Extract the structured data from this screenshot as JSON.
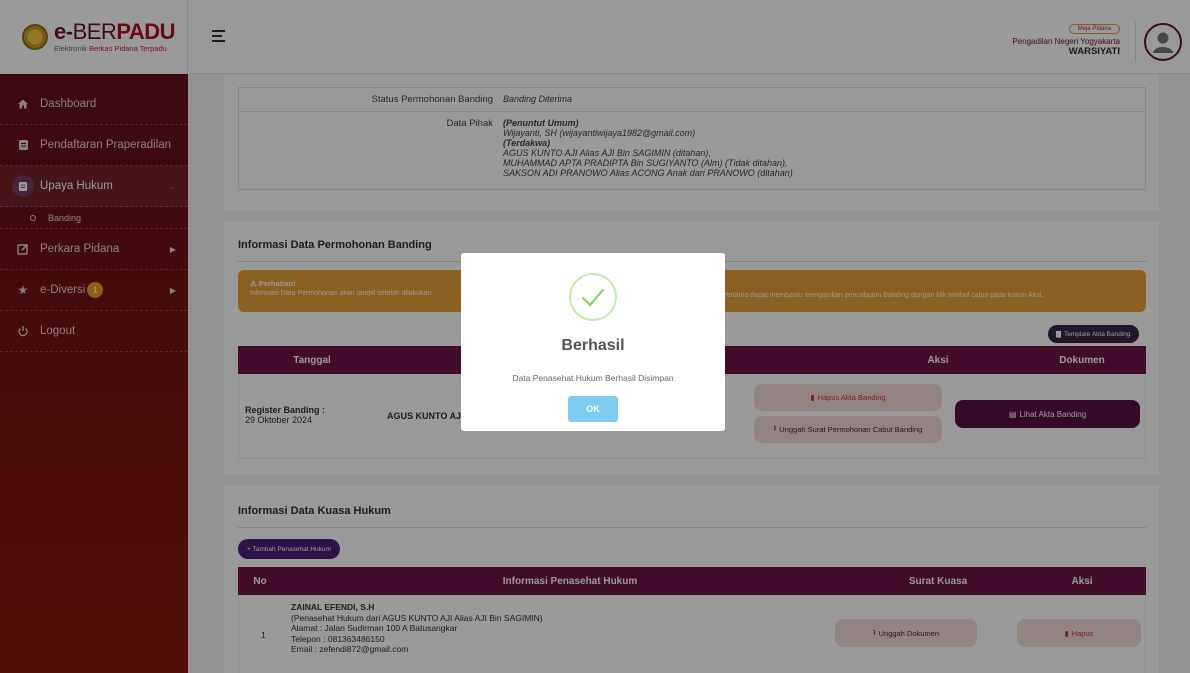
{
  "brand": {
    "title_e": "e-",
    "title_ber": "BER",
    "title_padu": "PADU",
    "subtitle_1": "Elektronik ",
    "subtitle_2": "Berkas Pidana Terpadu"
  },
  "sidebar": {
    "items": [
      {
        "label": "Dashboard",
        "icon": "home-icon"
      },
      {
        "label": "Pendaftaran Praperadilan",
        "icon": "file-icon"
      },
      {
        "label": "Upaya Hukum",
        "icon": "file-icon"
      },
      {
        "label": "Banding",
        "icon": "circle-icon"
      },
      {
        "label": "Perkara Pidana",
        "icon": "edit-icon"
      },
      {
        "label": "e-Diversi",
        "icon": "star-icon",
        "badge": "1"
      },
      {
        "label": "Logout",
        "icon": "power-icon"
      }
    ]
  },
  "header": {
    "role": "Meja Pidana",
    "court": "Pengadilan Negeri Yogyakarta",
    "user": "WARSIYATI"
  },
  "permohonan": {
    "status_label": "Status Permohonan Banding",
    "status_value": "Banding Diterima",
    "pihak_label": "Data Pihak",
    "penuntut_title": "(Penuntut Umum)",
    "penuntut_name": "Wijayanti, SH (wijayantiwijaya1982@gmail.com)",
    "terdakwa_title": "(Terdakwa)",
    "terdakwa_1": "AGUS KUNTO AJI Alias AJI Bin SAGIMIN (ditahan),",
    "terdakwa_2": "MUHAMMAD APTA PRADIPTA Bin SUGIYANTO (Alm) (Tidak ditahan),",
    "terdakwa_3": "SAKSON ADI PRANOWO Alias ACONG Anak dari PRANOWO (ditahan)"
  },
  "banding": {
    "title": "Informasi Data Permohonan Banding",
    "alert_title": "Perhatian!",
    "alert_text": "Informasi Data Permohonan akan tampil setelah dilakukan",
    "alert_tail": "at Pertama dapat membantu mengajukan pencabutan Banding dengan klik tombol cabut pada kolom Aksi.",
    "template_btn": "Template Akta Banding",
    "headers": [
      "Tanggal",
      "Aksi",
      "Dokumen"
    ],
    "reg_label": "Register Banding :",
    "reg_date": "29 Oktober 2024",
    "terdakwa": "AGUS KUNTO AJI",
    "hapus_btn": "Hapus Akta Banding",
    "unggah_btn": "Unggah Surat Permohonan Cabut Banding",
    "lihat_btn": "Lihat Akta Banding"
  },
  "kuasa": {
    "title": "Informasi Data Kuasa Hukum",
    "add_btn": "+ Tambah Penasehat Hukum",
    "headers": [
      "No",
      "Informasi Penasehat Hukum",
      "Surat Kuasa",
      "Aksi"
    ],
    "row": {
      "no": "1",
      "name": "ZAINAL EFENDI, S.H",
      "desc": "(Penasehat Hukum dari AGUS KUNTO AJI Alias AJI Bin SAGIMIN)",
      "alamat": "Alamat : Jalan Sudirman 100 A Batusangkar",
      "telepon": "Telepon : 081363486150",
      "email": "Email : zefendi872@gmail.com",
      "unggah": "Unggah Dokumen",
      "hapus": "Hapus"
    }
  },
  "modal": {
    "title": "Berhasil",
    "text": "Data Penasehat Hukum Berhasil Disimpan",
    "ok": "OK"
  }
}
